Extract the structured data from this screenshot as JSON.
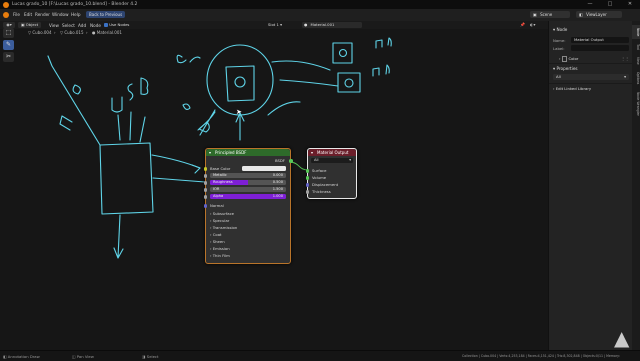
{
  "titlebar": {
    "title": "Lucas grado_10 [F:\\Lucas grado_10.blend] - Blender 4.2",
    "minimize": "—",
    "maximize": "□",
    "close": "✕"
  },
  "menubar": {
    "items": [
      "File",
      "Edit",
      "Render",
      "Window",
      "Help"
    ],
    "back_to_previous": "Back to Previous",
    "scene": "Scene",
    "view_layer": "ViewLayer"
  },
  "header": {
    "object": "Object",
    "view": "View",
    "select": "Select",
    "add": "Add",
    "node": "Node",
    "use_nodes": "Use Nodes",
    "slot": "Slot 1",
    "material": "Material.001"
  },
  "breadcrumb": [
    "Cubo.004",
    "Cubo.015",
    "Material.001"
  ],
  "toolbar": {
    "tools": [
      "select-tool",
      "annotate-tool",
      "cut-tool"
    ]
  },
  "material_output": {
    "title": "Material Output",
    "target": "All",
    "inputs": [
      "Surface",
      "Volume",
      "Displacement",
      "Thickness"
    ]
  },
  "principled_bsdf": {
    "title": "Principled BSDF",
    "output": "BSDF",
    "base_color_label": "Base Color",
    "sliders": [
      {
        "label": "Metallic",
        "value": "0.000",
        "fill": 0.0
      },
      {
        "label": "Roughness",
        "value": "0.500",
        "fill": 0.5
      },
      {
        "label": "IOR",
        "value": "1.500",
        "fill": 0.0
      },
      {
        "label": "Alpha",
        "value": "1.000",
        "fill": 1.0
      }
    ],
    "normal_label": "Normal",
    "sections": [
      "Subsurface",
      "Specular",
      "Transmission",
      "Coat",
      "Sheen",
      "Emission",
      "Thin Film"
    ]
  },
  "sidebar": {
    "node_section": "Node",
    "name_label": "Name:",
    "name_value": "Material Output",
    "label_label": "Label:",
    "label_value": "",
    "color_label": "Color",
    "properties_section": "Properties",
    "target_value": "All",
    "linked_library": "Edit Linked Library",
    "tabs": [
      "Node",
      "Tool",
      "View",
      "Options",
      "Node Wrangler"
    ]
  },
  "statusbar": {
    "left": [
      "Annotation Draw",
      "Pan View",
      "Select"
    ],
    "right": "Collection | Cubo.004 | Verts:4,253,184 | Faces:4,151,424 | Tris:8,302,848 | Objects:0/11 | Memory:"
  },
  "colors": {
    "annotation": "#5fd4e8",
    "bsdf_header": "#2e6b2a",
    "output_header": "#6b1e2a",
    "slider_active": "#7e1fd6",
    "accent_blue": "#2a5ab0"
  },
  "watermark": "▲"
}
